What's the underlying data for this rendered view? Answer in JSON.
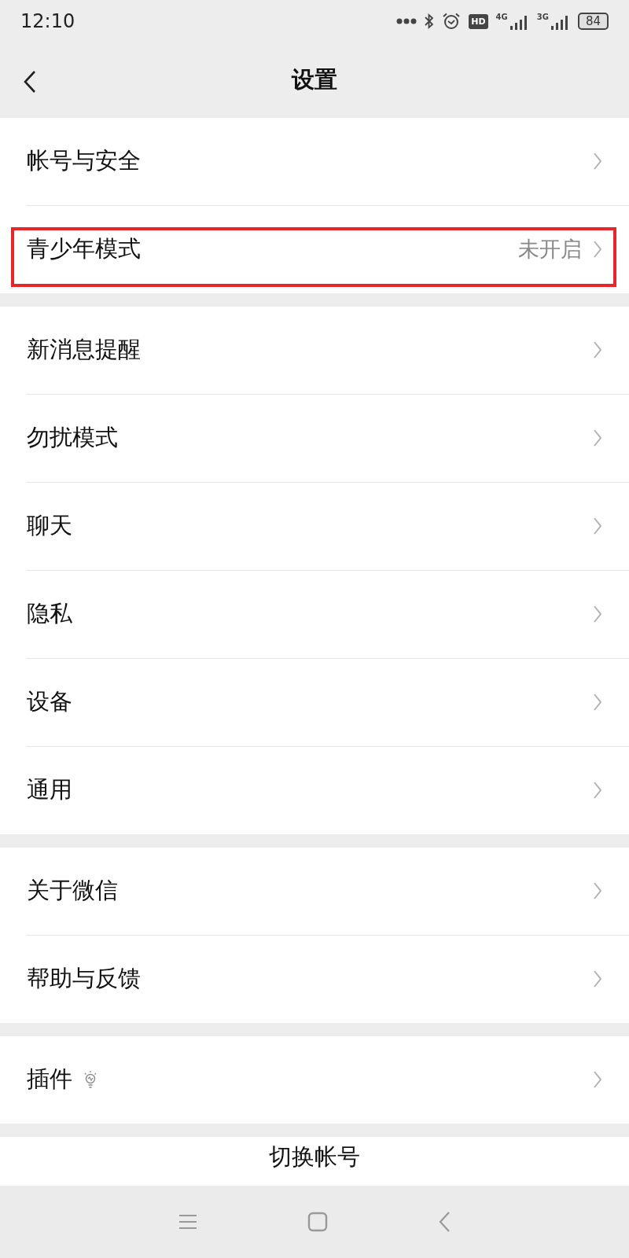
{
  "status_bar": {
    "time": "12:10",
    "hd": "HD",
    "network_1": "4G",
    "network_2": "3G",
    "battery": "84"
  },
  "header": {
    "title": "设置"
  },
  "groups": [
    {
      "rows": [
        {
          "label": "帐号与安全",
          "highlighted": false
        },
        {
          "label": "青少年模式",
          "value": "未开启",
          "highlighted": true
        }
      ]
    },
    {
      "rows": [
        {
          "label": "新消息提醒",
          "highlighted": false
        },
        {
          "label": "勿扰模式",
          "highlighted": false
        },
        {
          "label": "聊天",
          "highlighted": false
        },
        {
          "label": "隐私",
          "highlighted": false
        },
        {
          "label": "设备",
          "highlighted": false
        },
        {
          "label": "通用",
          "highlighted": false
        }
      ]
    },
    {
      "rows": [
        {
          "label": "关于微信",
          "highlighted": false
        },
        {
          "label": "帮助与反馈",
          "highlighted": false
        }
      ]
    },
    {
      "rows": [
        {
          "label": "插件",
          "new_feature": true,
          "highlighted": false
        }
      ]
    }
  ],
  "switch_account": "切换帐号"
}
